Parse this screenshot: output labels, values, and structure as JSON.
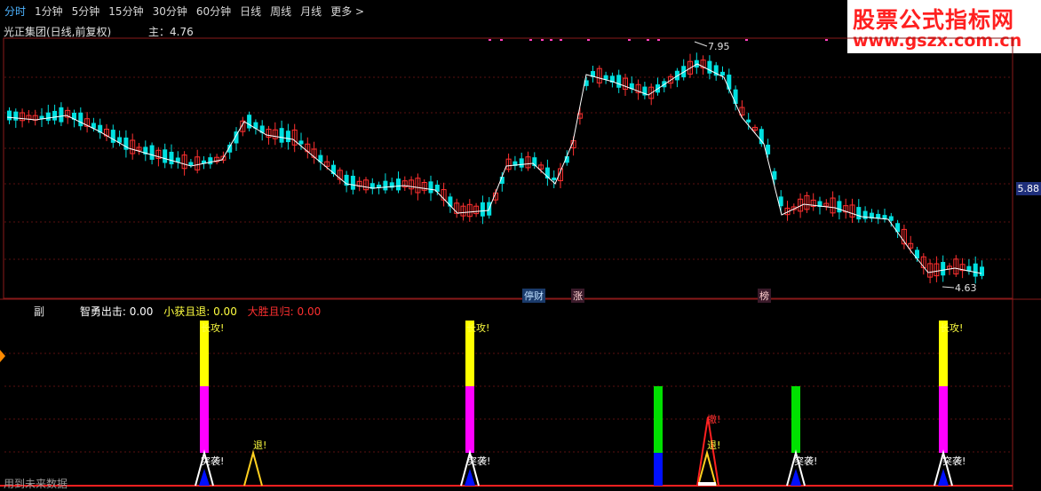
{
  "tabs": [
    "分时",
    "1分钟",
    "5分钟",
    "15分钟",
    "30分钟",
    "60分钟",
    "日线",
    "周线",
    "月线",
    "更多 >"
  ],
  "active_tab": 0,
  "stock_title": "光正集团(日线,前复权)",
  "main_indicator": "主：4.76",
  "watermark": {
    "line1": "股票公式指标网",
    "line2": "www.gszx.com.cn"
  },
  "axis_price_label": "5.88",
  "high_label": "7.95",
  "low_label": "4.63",
  "badges": [
    "停财",
    "涨",
    "榜"
  ],
  "sub_label": "副",
  "legend": {
    "item1": "智勇出击: 0.00",
    "item2": "小获且退: 0.00",
    "item3": "大胜且归: 0.00"
  },
  "signal_texts": {
    "attack": "出攻!",
    "attack_full": "长攻!",
    "retreat": "退!",
    "pounce": "突袭!",
    "flee": "撤!"
  },
  "footer": "用到未来数据",
  "colors": {
    "up": "#ff3030",
    "down": "#00e0e0",
    "yellow": "#ffff00",
    "magenta": "#ff00ff",
    "green": "#00e000",
    "blue": "#0010ff",
    "red": "#ff2020",
    "active_tab": "#4db3ff"
  }
}
